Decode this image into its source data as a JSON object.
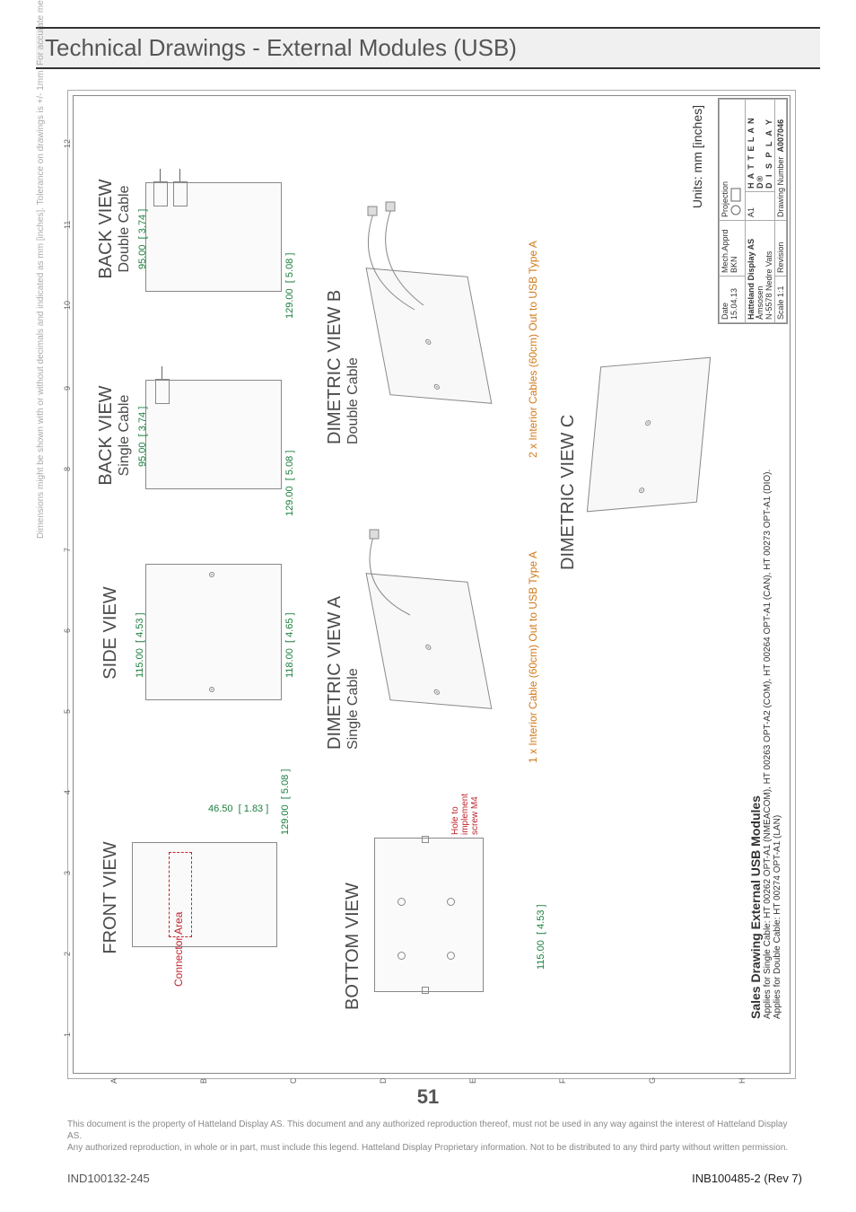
{
  "page": {
    "title": "Technical Drawings - External Modules (USB)",
    "side_note": "Dimensions might be shown with or without decimals and indicated as mm [inches]. Tolerance on drawings is +/- 1mm. For accurate measurements, check relevant DWG file.",
    "page_number": "51",
    "footer_left": "IND100132-245",
    "footer_right": "INB100485-2 (Rev 7)",
    "legal_line1": "This document is the property of Hatteland Display AS. This document and any authorized reproduction thereof, must not be used in any way against the interest of Hatteland Display AS.",
    "legal_line2": "Any authorized reproduction, in whole or in part, must include this legend. Hatteland Display Proprietary information. Not to be distributed to any third party without written permission."
  },
  "grid": {
    "cols": [
      "1",
      "2",
      "3",
      "4",
      "5",
      "6",
      "7",
      "8",
      "9",
      "10",
      "11",
      "12"
    ],
    "rows": [
      "A",
      "B",
      "C",
      "D",
      "E",
      "F",
      "G",
      "H"
    ]
  },
  "views": {
    "front": {
      "title": "FRONT VIEW",
      "connector_area": "Connector Area",
      "h": {
        "mm": "129.00",
        "in": "[ 5.08 ]"
      },
      "d": {
        "mm": "46.50",
        "in": "[ 1.83 ]"
      }
    },
    "side": {
      "title": "SIDE VIEW",
      "w": {
        "mm": "115.00",
        "in": "[ 4.53 ]"
      },
      "w2": {
        "mm": "118.00",
        "in": "[ 4.65 ]"
      }
    },
    "back_s": {
      "title": "BACK VIEW",
      "sub": "Single Cable",
      "w": {
        "mm": "95.00",
        "in": "[ 3.74 ]"
      },
      "h": {
        "mm": "129.00",
        "in": "[ 5.08 ]"
      }
    },
    "back_d": {
      "title": "BACK VIEW",
      "sub": "Double Cable",
      "w": {
        "mm": "95.00",
        "in": "[ 3.74 ]"
      },
      "h": {
        "mm": "129.00",
        "in": "[ 5.08 ]"
      }
    },
    "bottom": {
      "title": "BOTTOM VIEW",
      "hole_note": "Hole to implement screw M4",
      "w": {
        "mm": "115.00",
        "in": "[ 4.53 ]"
      }
    },
    "dim_a": {
      "title": "DIMETRIC VIEW A",
      "sub": "Single Cable",
      "note": "1 x Interior Cable (60cm) Out to USB Type A"
    },
    "dim_b": {
      "title": "DIMETRIC VIEW B",
      "sub": "Double Cable",
      "note": "2 x Interior Cables (60cm) Out to USB Type A"
    },
    "dim_c": {
      "title": "DIMETRIC VIEW C"
    }
  },
  "units_label": "Units: mm [inches]",
  "title_block": {
    "date": "15.04.13",
    "mech_apprd": "BKN",
    "company": "Hatteland Display AS",
    "addr1": "Åmsosen",
    "addr2": "N-5578 Nedre Vats",
    "size": "A1",
    "scale_lbl": "Scale",
    "scale": "1:1",
    "proj_lbl": "Projection",
    "logo1": "H A T T E L A N D®",
    "logo2": "D I S P L A Y",
    "dwg_lbl": "Drawing Number",
    "dwg_no": "A007046",
    "rev_lbl": "Revision"
  },
  "sales": {
    "title": "Sales Drawing External USB Modules",
    "line1": "Applies for Single Cable: HT 00262 OPT-A1 (NMEACOM), HT 00263 OPT-A2 (COM), HT 00264 OPT-A1 (CAN), HT 00273 OPT-A1 (DIO).",
    "line2": "Applies for Double Cable: HT 00274 OPT-A1 (LAN)"
  }
}
